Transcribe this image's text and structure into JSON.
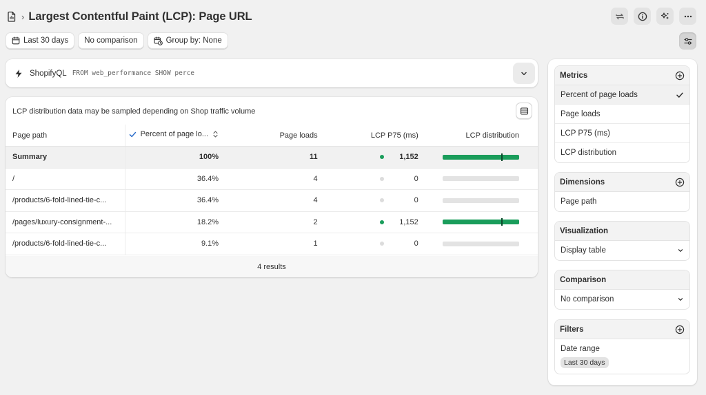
{
  "header": {
    "title": "Largest Contentful Paint (LCP): Page URL",
    "breadcrumb_separator": "›",
    "actions": [
      "refresh-icon",
      "info-icon",
      "sparkle-icon",
      "more-icon"
    ]
  },
  "toolbar": {
    "date_label": "Last 30 days",
    "comparison_label": "No comparison",
    "group_label": "Group by: None"
  },
  "query": {
    "label": "ShopifyQL",
    "code": "FROM web_performance SHOW perce"
  },
  "table": {
    "notice": "LCP distribution data may be sampled depending on Shop traffic volume",
    "headers": {
      "path": "Page path",
      "percent": "Percent of page lo...",
      "loads": "Page loads",
      "lcp": "LCP P75 (ms)",
      "distribution": "LCP distribution"
    },
    "summary": {
      "path": "Summary",
      "percent": "100%",
      "loads": "11",
      "lcp": "1,152",
      "status": "good",
      "fill": 1.0,
      "marker": 0.77
    },
    "rows": [
      {
        "path": "/",
        "percent": "36.4%",
        "loads": "4",
        "lcp": "0",
        "status": "none",
        "fill": 0,
        "marker": null
      },
      {
        "path": "/products/6-fold-lined-tie-c...",
        "percent": "36.4%",
        "loads": "4",
        "lcp": "0",
        "status": "none",
        "fill": 0,
        "marker": null
      },
      {
        "path": "/pages/luxury-consignment-...",
        "percent": "18.2%",
        "loads": "2",
        "lcp": "1,152",
        "status": "good",
        "fill": 1.0,
        "marker": 0.77
      },
      {
        "path": "/products/6-fold-lined-tie-c...",
        "percent": "9.1%",
        "loads": "1",
        "lcp": "0",
        "status": "none",
        "fill": 0,
        "marker": null
      }
    ],
    "footer": "4 results"
  },
  "side": {
    "metrics": {
      "title": "Metrics",
      "items": [
        "Percent of page loads",
        "Page loads",
        "LCP P75 (ms)",
        "LCP distribution"
      ],
      "selected": "Percent of page loads"
    },
    "dimensions": {
      "title": "Dimensions",
      "items": [
        "Page path"
      ]
    },
    "visualization": {
      "title": "Visualization",
      "value": "Display table"
    },
    "comparison": {
      "title": "Comparison",
      "value": "No comparison"
    },
    "filters": {
      "title": "Filters",
      "item": "Date range",
      "chip": "Last 30 days"
    }
  },
  "colors": {
    "good": "#1a9d5b",
    "none": "#dcdcdc",
    "bar_track": "#e3e3e3"
  }
}
